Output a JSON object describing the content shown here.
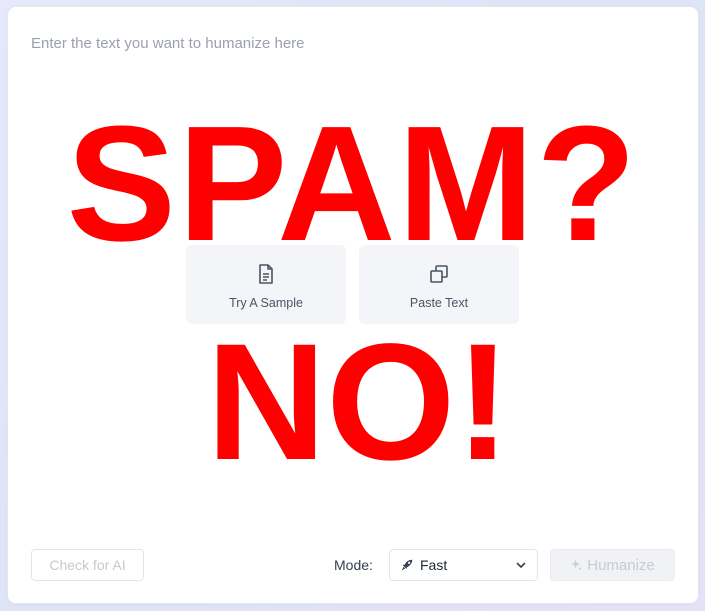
{
  "editor": {
    "placeholder": "Enter the text you want to humanize here"
  },
  "tiles": {
    "sample": {
      "label": "Try A Sample",
      "icon": "document-icon"
    },
    "paste": {
      "label": "Paste Text",
      "icon": "copy-icon"
    }
  },
  "overlay": {
    "line1": "SPAM?",
    "line2": "NO!",
    "color": "#ff0000"
  },
  "footer": {
    "check_label": "Check for AI",
    "mode_label": "Mode:",
    "mode_value": "Fast",
    "mode_icon": "rocket-icon",
    "humanize_label": "Humanize",
    "humanize_icon": "sparkle-icon"
  }
}
